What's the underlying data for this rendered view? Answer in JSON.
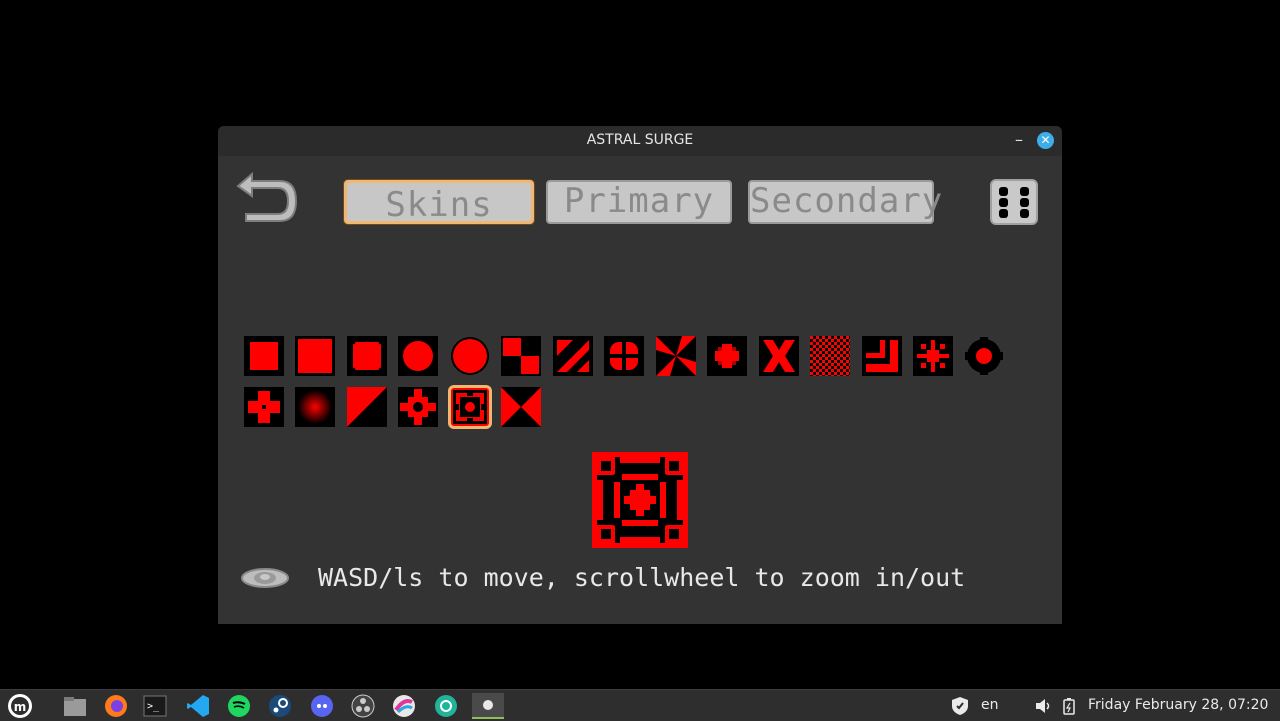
{
  "window": {
    "title": "ASTRAL SURGE",
    "minimize_glyph": "–",
    "close_glyph": "✕"
  },
  "tabs": [
    {
      "label": "Skins",
      "active": true
    },
    {
      "label": "Primary",
      "active": false
    },
    {
      "label": "Secondary",
      "active": false
    }
  ],
  "icons": {
    "back": "back-arrow-icon",
    "random": "dice-icon",
    "visibility": "eye-icon"
  },
  "skins": {
    "count": 21,
    "selected_index": 19,
    "accent_color": "#ff0000",
    "selection_color": "#f0b770"
  },
  "hint": "WASD/ls to move, scrollwheel to zoom in/out",
  "taskbar": {
    "apps": [
      "mint-menu-icon",
      "files-icon",
      "firefox-icon",
      "terminal-icon",
      "vscode-icon",
      "spotify-icon",
      "steam-icon",
      "discord-icon",
      "obs-icon",
      "krita-icon",
      "aperture-icon",
      "game-icon"
    ],
    "keyboard_layout": "en",
    "clock": "Friday February 28, 07:20"
  }
}
